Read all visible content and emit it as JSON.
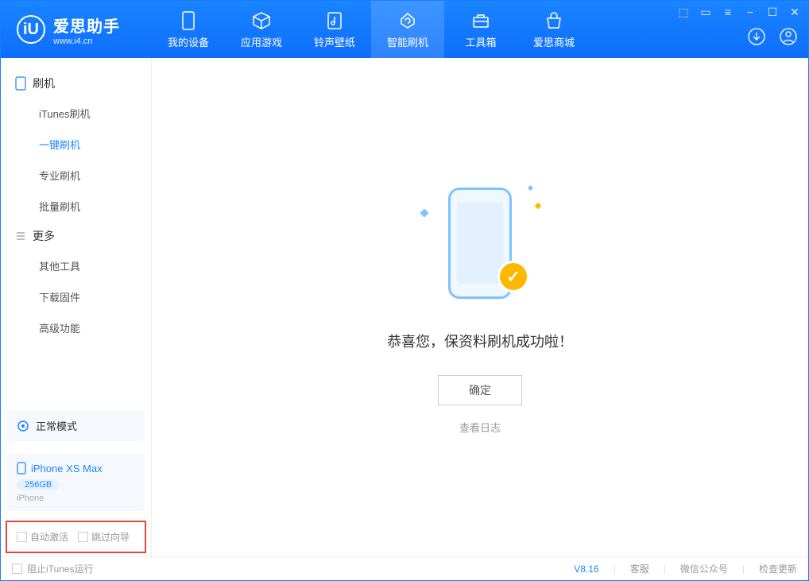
{
  "app": {
    "logo_title": "爱思助手",
    "logo_sub": "www.i4.cn"
  },
  "nav": [
    {
      "label": "我的设备",
      "icon": "device"
    },
    {
      "label": "应用游戏",
      "icon": "cube"
    },
    {
      "label": "铃声壁纸",
      "icon": "music"
    },
    {
      "label": "智能刷机",
      "icon": "refresh",
      "active": true
    },
    {
      "label": "工具箱",
      "icon": "toolbox"
    },
    {
      "label": "爱思商城",
      "icon": "store"
    }
  ],
  "window_controls": [
    "⬚",
    "▭",
    "≡",
    "−",
    "☐",
    "✕"
  ],
  "sidebar": {
    "section1_title": "刷机",
    "items1": [
      {
        "label": "iTunes刷机"
      },
      {
        "label": "一键刷机",
        "active": true
      },
      {
        "label": "专业刷机"
      },
      {
        "label": "批量刷机"
      }
    ],
    "section2_title": "更多",
    "items2": [
      {
        "label": "其他工具"
      },
      {
        "label": "下载固件"
      },
      {
        "label": "高级功能"
      }
    ],
    "mode_label": "正常模式",
    "device_name": "iPhone XS Max",
    "device_storage": "256GB",
    "device_type": "iPhone",
    "checkbox1": "自动激活",
    "checkbox2": "跳过向导"
  },
  "main": {
    "success_text": "恭喜您，保资料刷机成功啦！",
    "ok_button": "确定",
    "view_log": "查看日志"
  },
  "footer": {
    "block_itunes": "阻止iTunes运行",
    "version": "V8.16",
    "links": [
      "客服",
      "微信公众号",
      "检查更新"
    ]
  }
}
